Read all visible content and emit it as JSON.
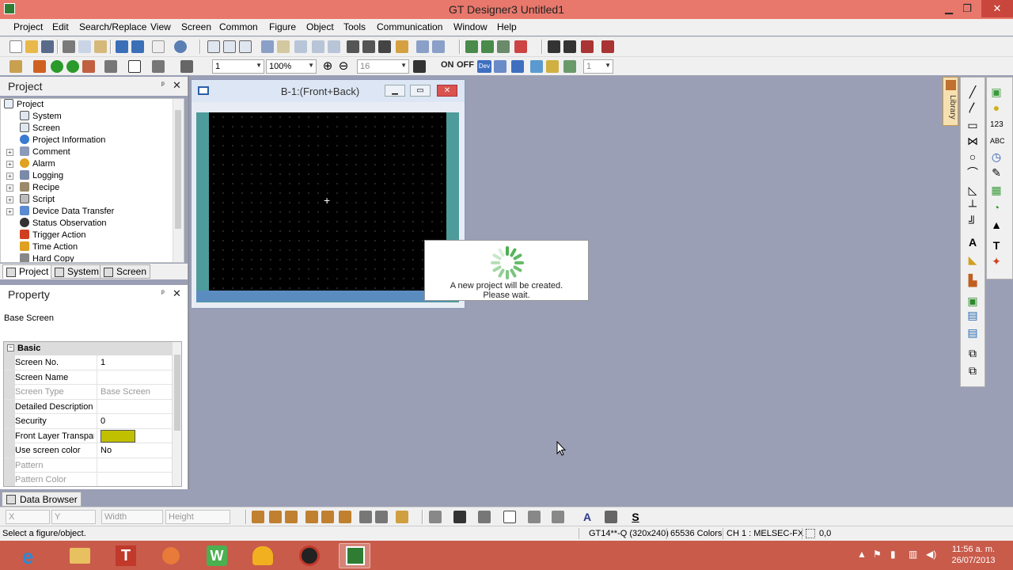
{
  "window": {
    "title": "GT Designer3 Untitled1",
    "minimize_glyph": "▁",
    "maximize_glyph": "❐",
    "close_glyph": "✕"
  },
  "menu": [
    "Project",
    "Edit",
    "Search/Replace",
    "View",
    "Screen",
    "Common",
    "Figure",
    "Object",
    "Tools",
    "Communication",
    "Window",
    "Help"
  ],
  "toolbar2": {
    "screen_no_combo": "1",
    "zoom_combo": "100%",
    "grid_combo": "16",
    "on_label": "ON",
    "off_label": "OFF",
    "dev_label": "Dev",
    "state_combo": "1"
  },
  "project_panel": {
    "title": "Project",
    "pin_glyph": "📌",
    "close_glyph": "✕",
    "tree": [
      {
        "label": "Project",
        "icon": "project-icon",
        "expandable": false
      },
      {
        "label": "System",
        "icon": "system-icon",
        "expandable": false
      },
      {
        "label": "Screen",
        "icon": "screen-icon",
        "expandable": false
      },
      {
        "label": "Project Information",
        "icon": "info-icon",
        "expandable": false
      },
      {
        "label": "Comment",
        "icon": "comment-icon",
        "expandable": true
      },
      {
        "label": "Alarm",
        "icon": "alarm-icon",
        "expandable": true
      },
      {
        "label": "Logging",
        "icon": "logging-icon",
        "expandable": true
      },
      {
        "label": "Recipe",
        "icon": "recipe-icon",
        "expandable": true
      },
      {
        "label": "Script",
        "icon": "script-icon",
        "expandable": true
      },
      {
        "label": "Device Data Transfer",
        "icon": "device-data-transfer-icon",
        "expandable": true
      },
      {
        "label": "Status Observation",
        "icon": "status-observation-icon",
        "expandable": false
      },
      {
        "label": "Trigger Action",
        "icon": "trigger-action-icon",
        "expandable": false
      },
      {
        "label": "Time Action",
        "icon": "time-action-icon",
        "expandable": false
      },
      {
        "label": "Hard Copy",
        "icon": "hard-copy-icon",
        "expandable": false
      }
    ],
    "tabs": [
      "Project",
      "System",
      "Screen"
    ]
  },
  "property_panel": {
    "title": "Property",
    "subject": "Base Screen",
    "category": "Basic",
    "rows": [
      {
        "key": "Screen No.",
        "value": "1",
        "dim": false
      },
      {
        "key": "Screen Name",
        "value": "",
        "dim": false
      },
      {
        "key": "Screen Type",
        "value": "Base Screen",
        "dim": true
      },
      {
        "key": "Detailed Description",
        "value": "",
        "dim": false
      },
      {
        "key": "Security",
        "value": "0",
        "dim": false
      },
      {
        "key": "Front Layer Transpare",
        "value": "",
        "dim": false,
        "swatch": "#c0c000"
      },
      {
        "key": "Use screen color",
        "value": "No",
        "dim": false
      },
      {
        "key": "Pattern",
        "value": "",
        "dim": true
      },
      {
        "key": "Pattern Color",
        "value": "",
        "dim": true
      }
    ]
  },
  "screen_window": {
    "title": "B-1:(Front+Back)",
    "canvas_color": "#000000",
    "frame_color": "#4e9b9b"
  },
  "progress_dialog": {
    "line1": "A new project will be created.",
    "line2": "Please wait."
  },
  "library_tab": "Library",
  "data_browser_tab": "Data Browser",
  "bottom_fields": {
    "x": "X",
    "y": "Y",
    "width": "Width",
    "height": "Height"
  },
  "status": {
    "message": "Select a figure/object.",
    "model": "GT14**-Q (320x240)",
    "colors": "65536 Colors",
    "channel": "CH 1 : MELSEC-FX",
    "coords": "0,0"
  },
  "clock": {
    "time": "11:56 a. m.",
    "date": "26/07/2013"
  },
  "colors": {
    "title_bar": "#e8786c",
    "taskbar": "#c95b4b",
    "workspace": "#9a9fb5",
    "swatch_yellow": "#c0c000"
  }
}
